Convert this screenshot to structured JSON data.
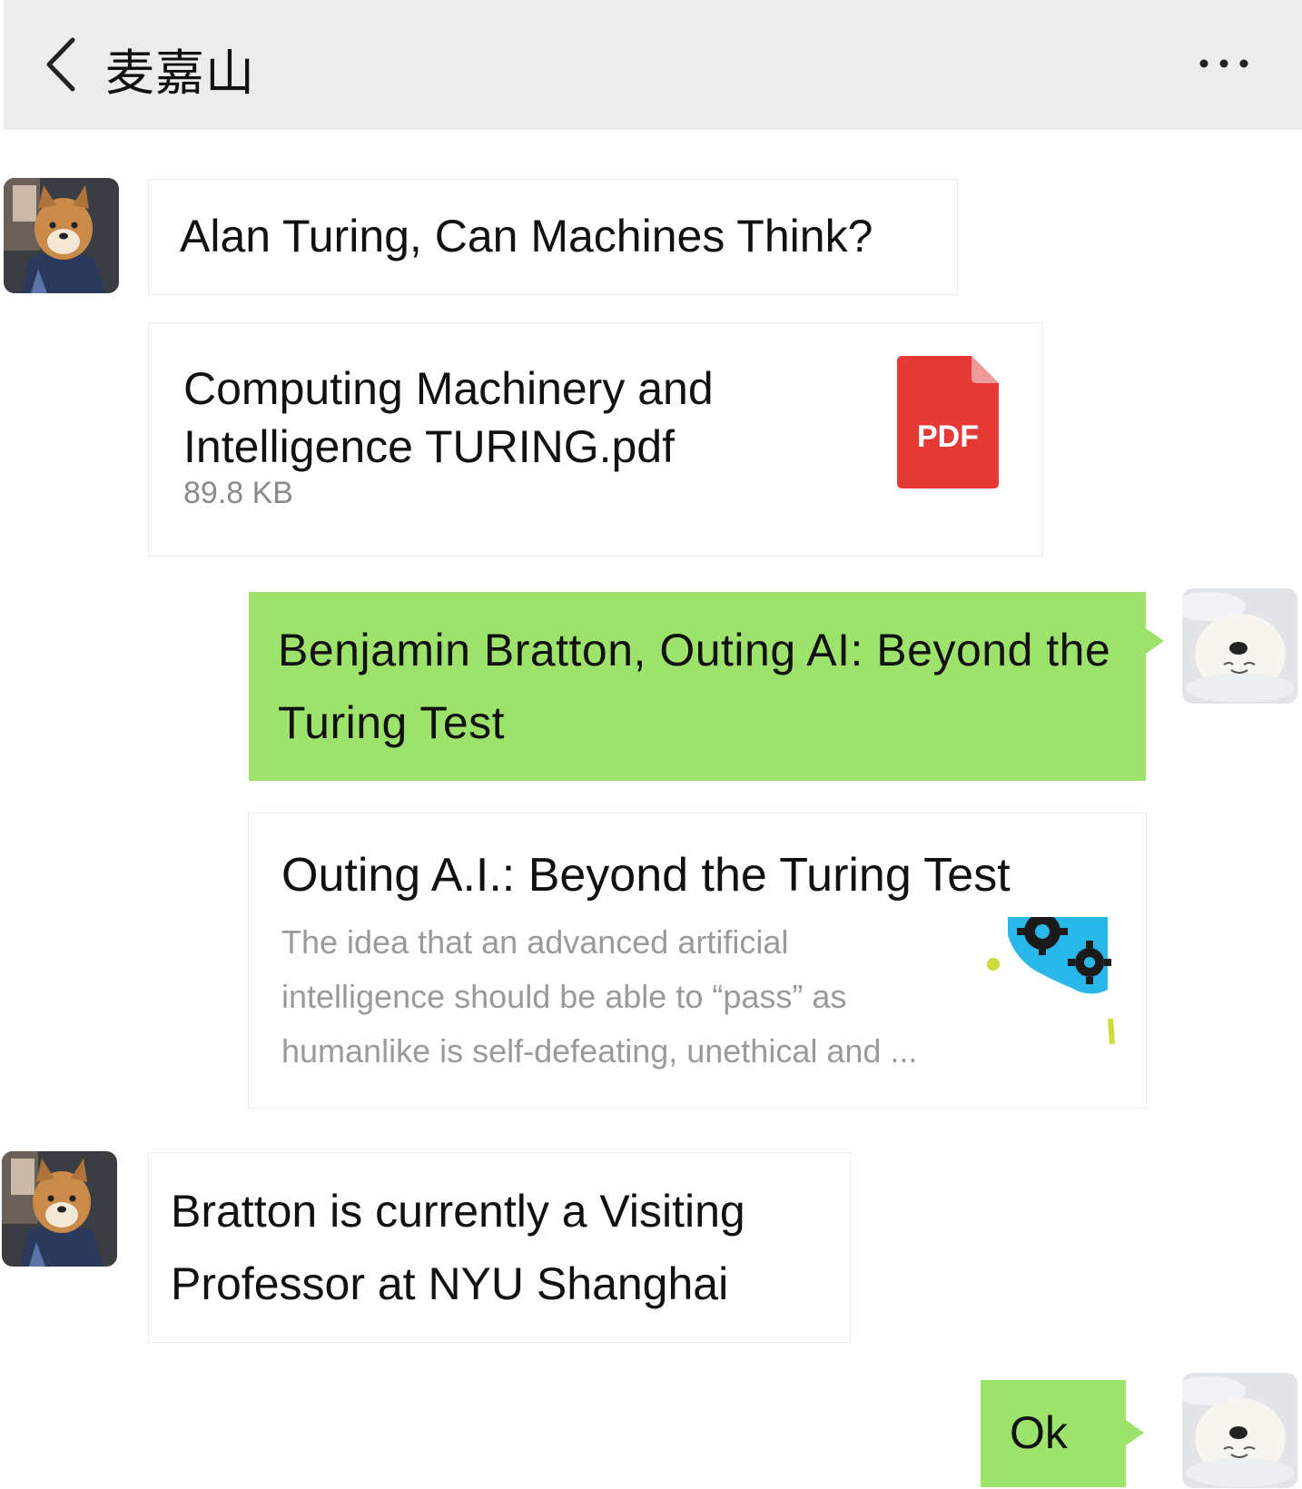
{
  "header": {
    "title": "麦嘉山"
  },
  "messages": {
    "m1": {
      "text": "Alan Turing, Can Machines Think?"
    },
    "m2": {
      "file_name": "Computing Machinery and Intelligence TURING.pdf",
      "file_size": "89.8 KB",
      "file_type_badge": "PDF"
    },
    "m3": {
      "text": "Benjamin Bratton, Outing AI: Beyond the Turing Test"
    },
    "m4": {
      "link_title": "Outing A.I.: Beyond the Turing Test",
      "link_description": "The idea that an advanced artificial intelligence should be able to “pass” as humanlike is self-defeating, unethical and ..."
    },
    "m5": {
      "text": "Bratton is currently a Visiting Professor at NYU Shanghai"
    },
    "m6": {
      "text": "Ok"
    }
  },
  "icons": {
    "back": "chevron-left-icon",
    "more": "more-dots-icon",
    "pdf": "pdf-file-icon",
    "link_thumbnail": "gears-illustration"
  },
  "colors": {
    "header_bg": "#ececec",
    "outgoing_bubble": "#9de26a",
    "incoming_bubble": "#ffffff",
    "pdf_red": "#e53935",
    "thumb_blue": "#29b6e8"
  }
}
